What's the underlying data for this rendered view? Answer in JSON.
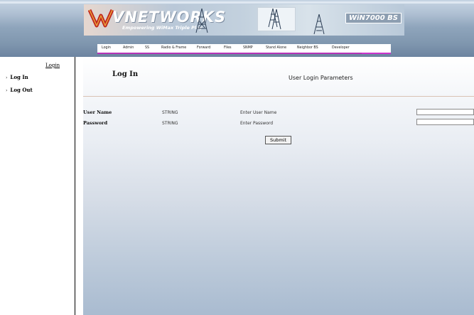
{
  "header": {
    "logo_text": "VNETWORKS",
    "tagline": "Empowering WiMax Triple Play",
    "product_label": "WiN7000 BS",
    "nav_items": [
      "Login",
      "Admin",
      "SS",
      "Radio & Frame",
      "Forward",
      "Files",
      "SNMP",
      "Stand Alone",
      "Neighbor BS",
      "Developer"
    ]
  },
  "sidebar": {
    "title": "Login",
    "items": [
      {
        "label": "Log In"
      },
      {
        "label": "Log Out"
      }
    ]
  },
  "main": {
    "title": "Log In",
    "subtitle": "User Login Parameters",
    "fields": [
      {
        "label": "User Name",
        "type": "STRING",
        "hint": "Enter User Name",
        "value": ""
      },
      {
        "label": "Password",
        "type": "STRING",
        "hint": "Enter Password",
        "value": ""
      }
    ],
    "submit_label": "Submit"
  },
  "colors": {
    "header_blue": "#7f96ae",
    "nav_accent": "#b733b7",
    "logo_red": "#c0251c",
    "main_gradient_bottom": "#a9bbd0"
  }
}
